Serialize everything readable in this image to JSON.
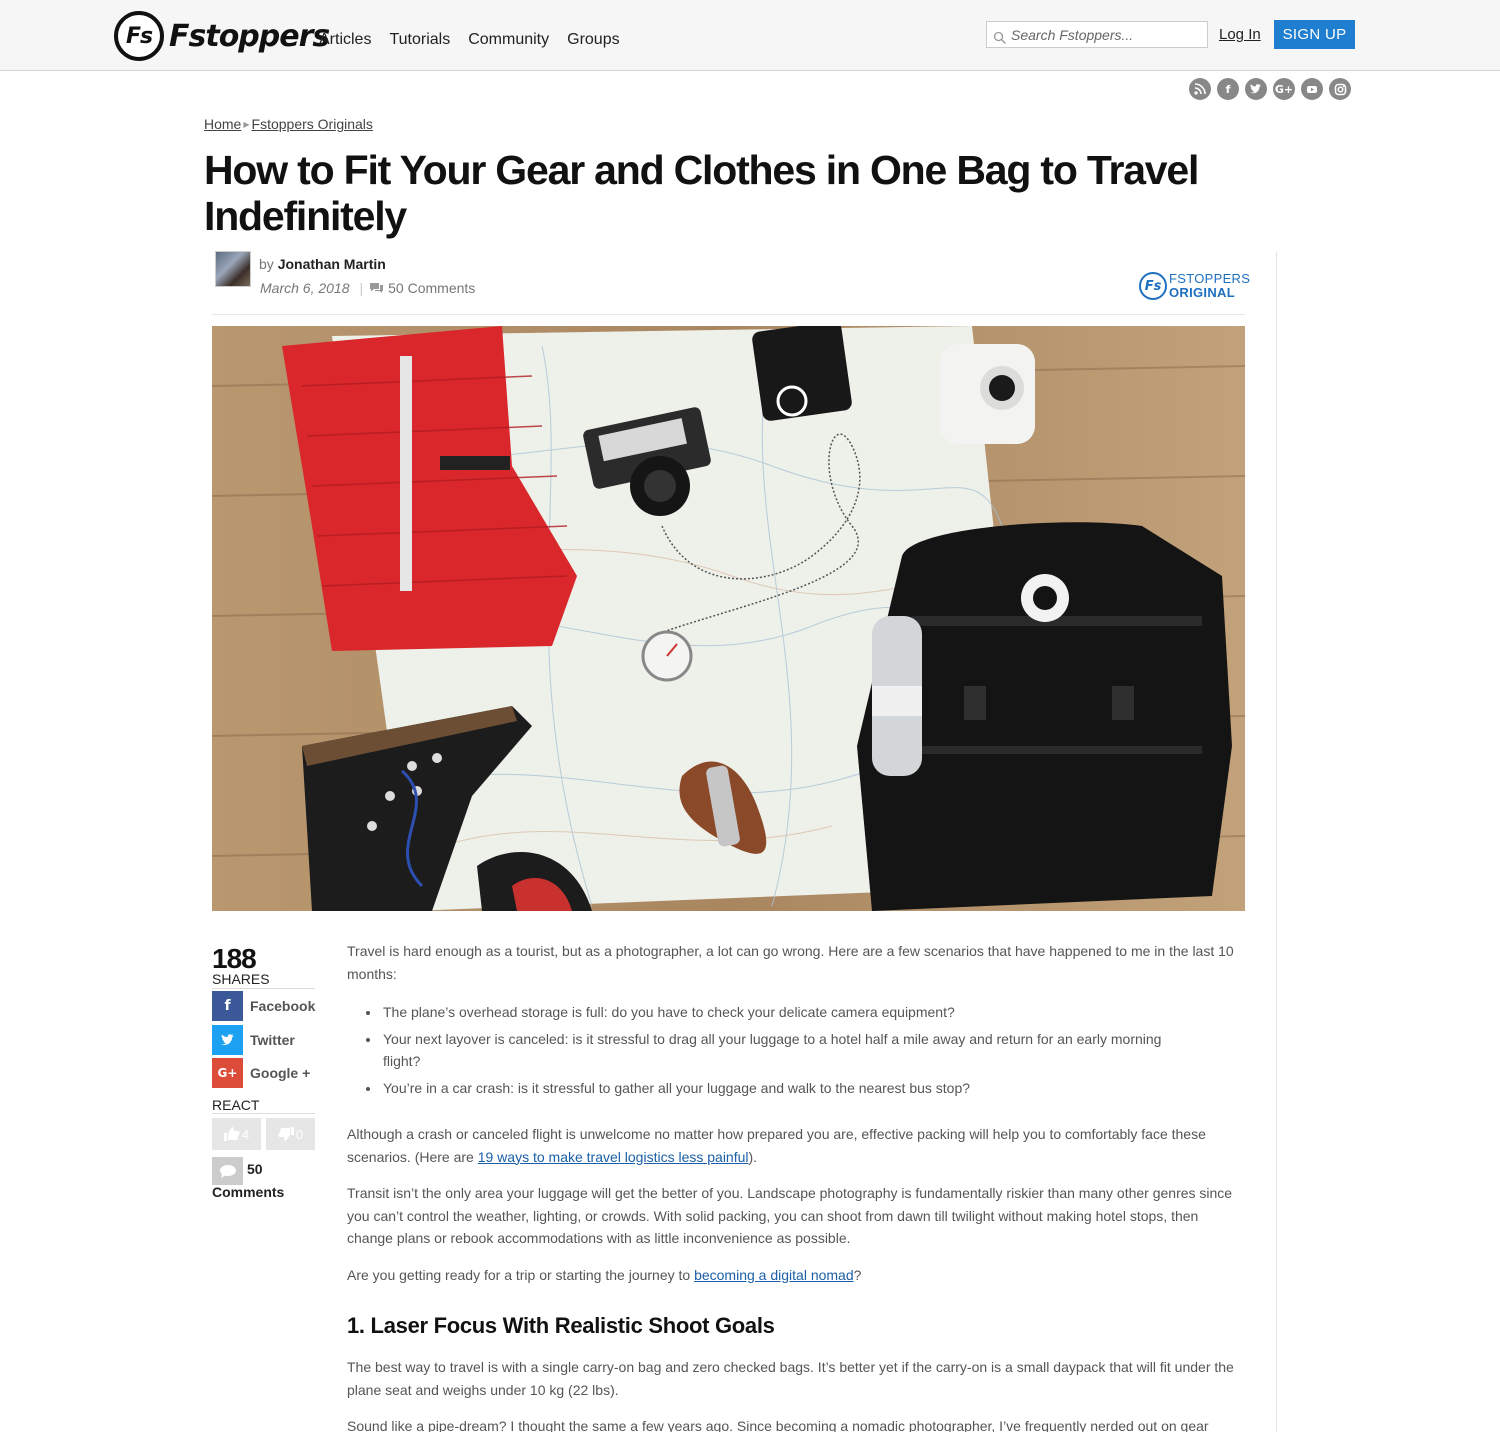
{
  "header": {
    "logo_mark": "Fs",
    "logo_text": "Fstoppers",
    "nav": [
      "Articles",
      "Tutorials",
      "Community",
      "Groups"
    ],
    "search_placeholder": "Search Fstoppers...",
    "login": "Log In",
    "signup": "SIGN UP"
  },
  "social_icons": [
    "rss-icon",
    "facebook-icon",
    "twitter-icon",
    "google-plus-icon",
    "youtube-icon",
    "instagram-icon"
  ],
  "breadcrumb": {
    "home": "Home",
    "section": "Fstoppers Originals"
  },
  "article": {
    "title": "How to Fit Your Gear and Clothes in One Bag to Travel Indefinitely",
    "by": "by",
    "author": "Jonathan Martin",
    "date": "March 6, 2018",
    "comments_link": "50 Comments",
    "badge_mark": "Fs",
    "badge_line1": "FSTOPPERS",
    "badge_line2": "ORIGINAL",
    "intro": "Travel is hard enough as a tourist, but as a photographer, a lot can go wrong. Here are a few scenarios that have happened to me in the last 10 months:",
    "bullets": [
      "The plane’s overhead storage is full: do you have to check your delicate camera equipment?",
      "Your next layover is canceled: is it stressful to drag all your luggage to a hotel half a mile away and return for an early morning flight?",
      "You’re in a car crash: is it stressful to gather all your luggage and walk to the nearest bus stop?"
    ],
    "p2_before": "Although a crash or canceled flight is unwelcome no matter how prepared you are, effective packing will help you to comfortably face these scenarios. (Here are ",
    "p2_link": "19 ways to make travel logistics less painful",
    "p2_after": ").",
    "p3": "Transit isn’t the only area your luggage will get the better of you. Landscape photography is fundamentally riskier than many other genres since you can’t control the weather, lighting, or crowds. With solid packing, you can shoot from dawn till twilight without making hotel stops, then change plans or rebook accommodations with as little inconvenience as possible.",
    "p4_before": "Are you getting ready for a trip or starting the journey to ",
    "p4_link": "becoming a digital nomad",
    "p4_after": "?",
    "h2": "1. Laser Focus With Realistic Shoot Goals",
    "p5": "The best way to travel is with a single carry-on bag and zero checked bags. It’s better yet if the carry-on is a small daypack that will fit under the plane seat and weighs under 10 kg (22 lbs).",
    "p6": "Sound like a pipe-dream? I thought the same a few years ago. Since becoming a nomadic photographer, I’ve frequently nerded out on gear"
  },
  "share": {
    "count": "188",
    "label": "SHARES",
    "facebook": "Facebook",
    "twitter": "Twitter",
    "google": "Google +",
    "google_icon": "G+",
    "react": "REACT",
    "likes": "4",
    "dislikes": "0",
    "comments_count": "50",
    "comments_label": "Comments"
  },
  "colors": {
    "brand_blue": "#1f7ed0",
    "facebook": "#3b5998",
    "twitter": "#1da1f2",
    "google": "#dd4b39"
  }
}
